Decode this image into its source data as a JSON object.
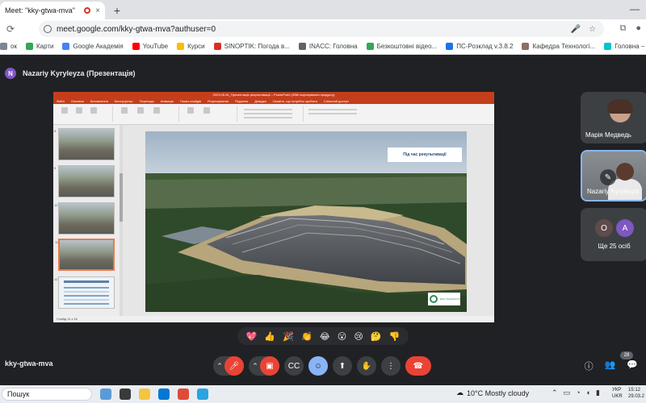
{
  "browser": {
    "tab_title": "Meet: \"kky-gtwa-mva\"",
    "tab_close": "×",
    "new_tab": "+",
    "minimize": "—",
    "url": "meet.google.com/kky-gtwa-mva?authuser=0",
    "bookmarks": [
      {
        "label": "ок",
        "color": "#7b8794"
      },
      {
        "label": "Карти",
        "color": "#34a853"
      },
      {
        "label": "Google Академія",
        "color": "#4285f4"
      },
      {
        "label": "YouTube",
        "color": "#ff0000"
      },
      {
        "label": "Курси",
        "color": "#fbbc05"
      },
      {
        "label": "SINOPTIK: Погода в...",
        "color": "#d93025"
      },
      {
        "label": "INACC: Головна",
        "color": "#5f6368"
      },
      {
        "label": "Безкоштовні відео...",
        "color": "#34a853"
      },
      {
        "label": "ПС-Розклад v.3.8.2",
        "color": "#1a73e8"
      },
      {
        "label": "Кафедра Технологі...",
        "color": "#8d6e63"
      },
      {
        "label": "Головна – Canva",
        "color": "#00c4cc"
      }
    ]
  },
  "meet": {
    "presenter_header": "Nazariy Kyryleyza (Презентація)",
    "presenter_initial": "N",
    "meeting_code": "kky-gtwa-mva",
    "participants": [
      {
        "name": "Марія Медведь"
      },
      {
        "name": "Nazariy Kyryleyza"
      }
    ],
    "others_initials": [
      "O",
      "A"
    ],
    "others_count_label": "Ще 25 осіб",
    "participants_badge": "28",
    "reactions": [
      "💖",
      "👍",
      "🎉",
      "👏",
      "😂",
      "😮",
      "😢",
      "🤔",
      "👎"
    ]
  },
  "presentation": {
    "window_title": "2023.05.26_Презентація рекультивації – PowerPoint (Збій ліцензування продукту)",
    "menu": [
      "Файл",
      "Основне",
      "Вставлення",
      "Конструктор",
      "Переходи",
      "Анімація",
      "Показ слайдів",
      "Рецензування",
      "Подання",
      "Довідка",
      "Скажіть, що потрібно зробити",
      "Спільний доступ"
    ],
    "slide_label": "Під час рекультивації",
    "logo_text": "ЕКО ТЕХНОЛОГІЇ",
    "status_left": "Слайд 11 з 16",
    "thumb_numbers": [
      "8",
      "9",
      "10",
      "11",
      "12"
    ]
  },
  "taskbar": {
    "search": "Пошук",
    "weather": "10°C  Mostly cloudy",
    "lang": [
      "УКР",
      "UKR"
    ],
    "time": "15:12",
    "date": "29.03.2"
  },
  "colors": {
    "meet_bg": "#202124",
    "end_call": "#ea4335",
    "active": "#8ab4f8",
    "ppt": "#c43e1c"
  }
}
